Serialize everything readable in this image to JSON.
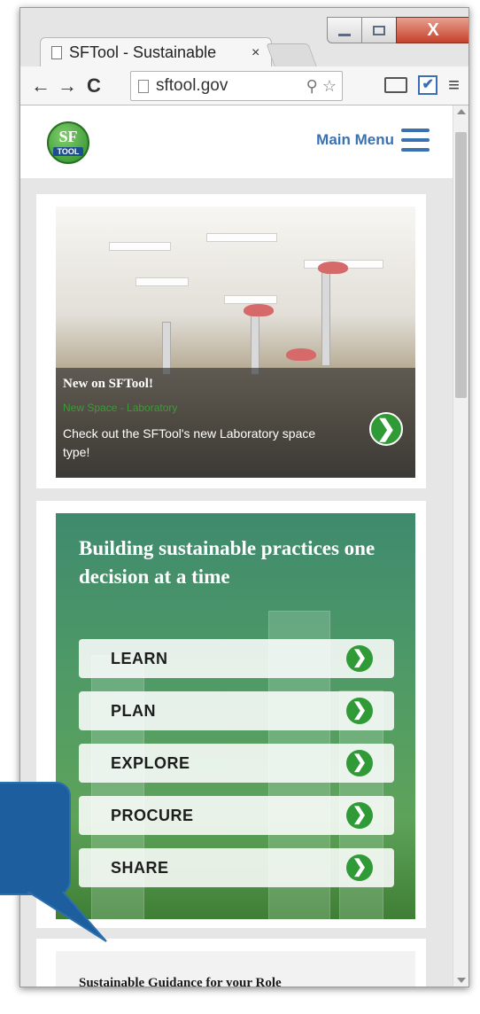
{
  "browser": {
    "tab_title": "SFTool - Sustainable",
    "tab_close": "×",
    "url": "sftool.gov",
    "nav_back": "←",
    "nav_forward": "→",
    "nav_reload": "C",
    "window_close": "X",
    "omnibox_icons": "⚲ ☆",
    "extension_check": "✔",
    "menu": "≡"
  },
  "site": {
    "logo_top": "SF",
    "logo_bottom": "TOOL",
    "main_menu": "Main Menu"
  },
  "feature": {
    "kicker": "New on SFTool!",
    "subtitle": "New Space - Laboratory",
    "text": "Check out the SFTool's new Laboratory space type!",
    "arrow": "❯"
  },
  "panel": {
    "title": "Building sustainable practices one decision at a time",
    "actions": [
      {
        "label": "LEARN",
        "arrow": "❯"
      },
      {
        "label": "PLAN",
        "arrow": "❯"
      },
      {
        "label": "EXPLORE",
        "arrow": "❯"
      },
      {
        "label": "PROCURE",
        "arrow": "❯"
      },
      {
        "label": "SHARE",
        "arrow": "❯"
      }
    ]
  },
  "guidance": {
    "title": "Sustainable Guidance for your Role"
  },
  "colors": {
    "accent_green": "#2f9a36",
    "link_blue": "#3a71b0",
    "callout_blue": "#1d5e9e"
  },
  "icons": [
    "document-icon",
    "search-icon",
    "star-icon",
    "cast-icon",
    "checkbox-icon",
    "menu-icon",
    "hamburger-icon",
    "chevron-right-icon"
  ]
}
